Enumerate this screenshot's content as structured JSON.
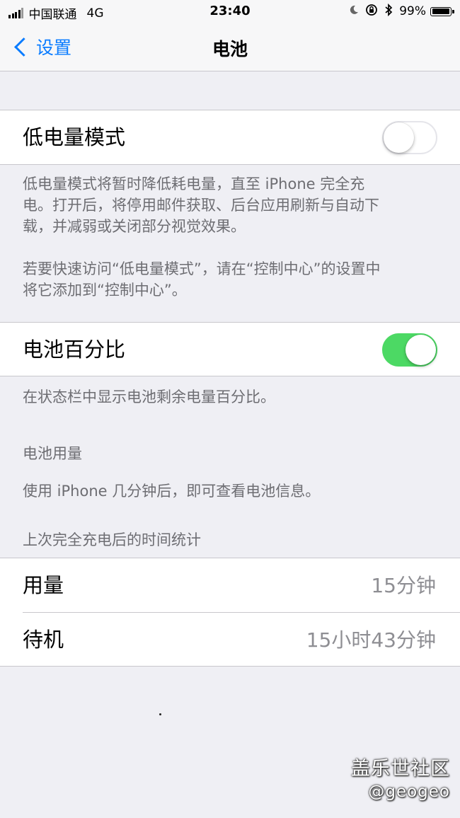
{
  "status_bar": {
    "carrier": "中国联通",
    "network": "4G",
    "time": "23:40",
    "battery_percent": "99%",
    "battery_level": 0.99,
    "icons": [
      "signal-icon",
      "moon-icon",
      "rotation-lock-icon",
      "bluetooth-icon",
      "battery-icon"
    ]
  },
  "nav": {
    "back_label": "设置",
    "title": "电池"
  },
  "low_power": {
    "label": "低电量模式",
    "enabled": false,
    "footer": "低电量模式将暂时降低耗电量，直至 iPhone 完全充\n电。打开后，将停用邮件获取、后台应用刷新与自动下\n载，并减弱或关闭部分视觉效果。\n\n若要快速访问“低电量模式”，请在“控制中心”的设置中\n将它添加到“控制中心”。"
  },
  "battery_percentage": {
    "label": "电池百分比",
    "enabled": true,
    "footer": "在状态栏中显示电池剩余电量百分比。"
  },
  "battery_usage": {
    "header": "电池用量",
    "message": "使用 iPhone 几分钟后，即可查看电池信息。"
  },
  "since_last_charge": {
    "header": "上次完全充电后的时间统计",
    "rows": [
      {
        "label": "用量",
        "value": "15分钟"
      },
      {
        "label": "待机",
        "value": "15小时43分钟"
      }
    ]
  },
  "watermark": {
    "brand": "盖乐世社区",
    "user": "@geogeo"
  },
  "colors": {
    "accent": "#0a7cff",
    "toggle_on": "#4cd964",
    "background": "#efeff4"
  }
}
